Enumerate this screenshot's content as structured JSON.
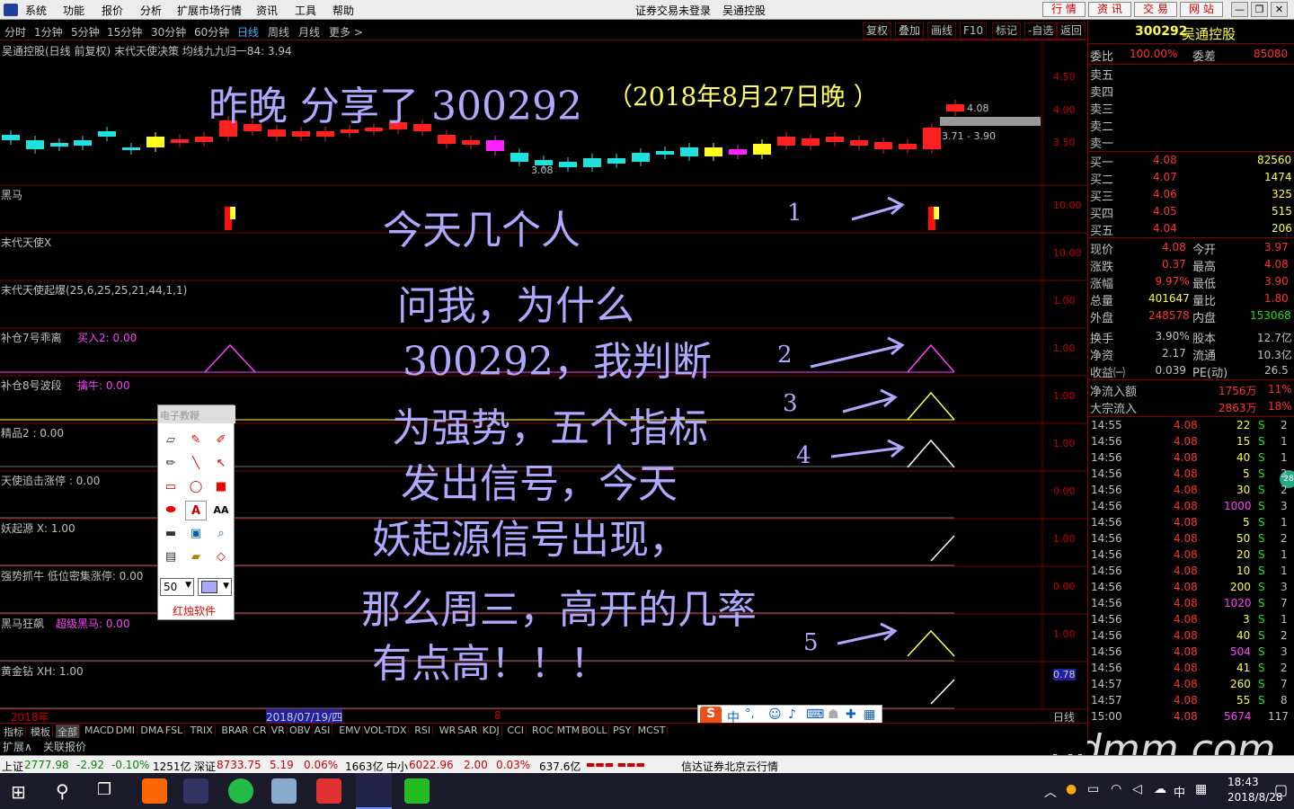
{
  "menu": {
    "items": [
      "系统",
      "功能",
      "报价",
      "分析",
      "扩展市场行情",
      "资讯",
      "工具",
      "帮助"
    ],
    "center_status": "证券交易未登录",
    "center_stock": "吴通控股",
    "quick": [
      "行 情",
      "资 讯",
      "交 易",
      "网 站"
    ]
  },
  "periods": {
    "items": [
      "分时",
      "1分钟",
      "5分钟",
      "15分钟",
      "30分钟",
      "60分钟",
      "日线",
      "周线",
      "月线",
      "更多 >"
    ],
    "tools": [
      "复权",
      "叠加",
      "画线",
      "F10",
      "标记",
      "-自选",
      "返回"
    ]
  },
  "chart": {
    "header": "吴通控股(日线 前复权) 末代天使决策  均线九九归一84: 3.94",
    "price_scale": [
      "4.50",
      "4.00",
      "3.50"
    ],
    "high_label": "4.08",
    "range_label": "3.71 - 3.90",
    "low_label": "3.08",
    "panels": [
      {
        "label": "黑马",
        "scale": "10.00"
      },
      {
        "label": "末代天使X",
        "scale": "10.00"
      },
      {
        "label": "末代天使起爆(25,6,25,25,21,44,1,1)",
        "scale": "1.00"
      },
      {
        "label": "补仓7号乖离",
        "extra": "买入2: 0.00",
        "scale": "1.00"
      },
      {
        "label": "补仓8号波段",
        "extra": "擒牛: 0.00",
        "scale": "1.00"
      },
      {
        "label": "精品2 : 0.00",
        "scale": "1.00"
      },
      {
        "label": "天使追击涨停 : 0.00",
        "scale": "0.00"
      },
      {
        "label": "妖起源  X: 1.00",
        "scale": "1.00"
      },
      {
        "label": "强势抓牛  低位密集涨停: 0.00",
        "scale": "0.00"
      },
      {
        "label": "黑马狂飙",
        "extra": "超级黑马: 0.00",
        "scale": "1.00"
      },
      {
        "label": "黄金钻  XH: 1.00",
        "scale": "0.78"
      }
    ],
    "date_left": "2018年",
    "date_mid": "2018/07/19/四",
    "date_right": "8",
    "day_label": "日线"
  },
  "annotations": {
    "title": "昨晚 分享了 300292",
    "title_date": "（2018年8月27日晚 ）",
    "lines": [
      "今天几个人",
      "问我，为什么",
      "300292，我判断",
      "为强势，五个指标",
      "发出信号，今天",
      "妖起源信号出现，",
      "那么周三，高开的几率",
      "有点高！！！"
    ],
    "numbers": [
      "1",
      "2",
      "3",
      "4",
      "5"
    ]
  },
  "toolbox": {
    "title": "电子教鞭",
    "size": "50",
    "brand": "红烛软件"
  },
  "idx_tabs": [
    "指标",
    "模板",
    "全部",
    "MACD",
    "DMI",
    "DMA",
    "FSL",
    "TRIX",
    "BRAR",
    "CR",
    "VR",
    "OBV",
    "ASI",
    "EMV",
    "VOL-TDX",
    "RSI",
    "WR",
    "SAR",
    "KDJ",
    "CCI",
    "ROC",
    "MTM",
    "BOLL",
    "PSY",
    "MCST"
  ],
  "sub_tabs": [
    "扩展∧",
    "关联报价"
  ],
  "quote": {
    "code": "300292",
    "name": "吴通控股",
    "weibi_label": "委比",
    "weibi": "100.00%",
    "weicha_label": "委差",
    "weicha": "85080",
    "sells": [
      "卖五",
      "卖四",
      "卖三",
      "卖二",
      "卖一"
    ],
    "buys": [
      {
        "l": "买一",
        "p": "4.08",
        "v": "82560"
      },
      {
        "l": "买二",
        "p": "4.07",
        "v": "1474"
      },
      {
        "l": "买三",
        "p": "4.06",
        "v": "325"
      },
      {
        "l": "买四",
        "p": "4.05",
        "v": "515"
      },
      {
        "l": "买五",
        "p": "4.04",
        "v": "206"
      }
    ],
    "stats": [
      {
        "a": "现价",
        "av": "4.08",
        "b": "今开",
        "bv": "3.97"
      },
      {
        "a": "涨跌",
        "av": "0.37",
        "b": "最高",
        "bv": "4.08"
      },
      {
        "a": "涨幅",
        "av": "9.97%",
        "b": "最低",
        "bv": "3.90"
      },
      {
        "a": "总量",
        "av": "401647",
        "b": "量比",
        "bv": "1.80"
      },
      {
        "a": "外盘",
        "av": "248578",
        "b": "内盘",
        "bv": "153068"
      },
      {
        "a": "换手",
        "av": "3.90%",
        "b": "股本",
        "bv": "12.7亿"
      },
      {
        "a": "净资",
        "av": "2.17",
        "b": "流通",
        "bv": "10.3亿"
      },
      {
        "a": "收益㈠",
        "av": "0.039",
        "b": "PE(动)",
        "bv": "26.5"
      }
    ],
    "flow1_label": "净流入额",
    "flow1": "1756万",
    "flow1p": "11%",
    "flow2_label": "大宗流入",
    "flow2": "2863万",
    "flow2p": "18%"
  },
  "ticks": [
    {
      "t": "14:55",
      "p": "4.08",
      "v": "22",
      "s": "S",
      "n": "2"
    },
    {
      "t": "14:56",
      "p": "4.08",
      "v": "15",
      "s": "S",
      "n": "1"
    },
    {
      "t": "14:56",
      "p": "4.08",
      "v": "40",
      "s": "S",
      "n": "1"
    },
    {
      "t": "14:56",
      "p": "4.08",
      "v": "5",
      "s": "S",
      "n": "2"
    },
    {
      "t": "14:56",
      "p": "4.08",
      "v": "30",
      "s": "S",
      "n": "2"
    },
    {
      "t": "14:56",
      "p": "4.08",
      "v": "1000",
      "s": "S",
      "n": "3"
    },
    {
      "t": "14:56",
      "p": "4.08",
      "v": "5",
      "s": "S",
      "n": "1"
    },
    {
      "t": "14:56",
      "p": "4.08",
      "v": "50",
      "s": "S",
      "n": "2"
    },
    {
      "t": "14:56",
      "p": "4.08",
      "v": "20",
      "s": "S",
      "n": "1"
    },
    {
      "t": "14:56",
      "p": "4.08",
      "v": "10",
      "s": "S",
      "n": "1"
    },
    {
      "t": "14:56",
      "p": "4.08",
      "v": "200",
      "s": "S",
      "n": "3"
    },
    {
      "t": "14:56",
      "p": "4.08",
      "v": "1020",
      "s": "S",
      "n": "7"
    },
    {
      "t": "14:56",
      "p": "4.08",
      "v": "3",
      "s": "S",
      "n": "1"
    },
    {
      "t": "14:56",
      "p": "4.08",
      "v": "40",
      "s": "S",
      "n": "2"
    },
    {
      "t": "14:56",
      "p": "4.08",
      "v": "504",
      "s": "S",
      "n": "3"
    },
    {
      "t": "14:56",
      "p": "4.08",
      "v": "41",
      "s": "S",
      "n": "2"
    },
    {
      "t": "14:57",
      "p": "4.08",
      "v": "260",
      "s": "S",
      "n": "7"
    },
    {
      "t": "14:57",
      "p": "4.08",
      "v": "55",
      "s": "S",
      "n": "8"
    },
    {
      "t": "15:00",
      "p": "4.08",
      "v": "5674",
      "s": "",
      "n": "117"
    }
  ],
  "status": {
    "sh_label": "上证",
    "sh": "2777.98",
    "sh_chg": "-2.92",
    "sh_pct": "-0.10%",
    "sh_amt": "1251亿",
    "sz_label": "深证",
    "sz": "8733.75",
    "sz_chg": "5.19",
    "sz_pct": "0.06%",
    "sz_amt": "1663亿",
    "zx_label": "中小",
    "zx": "6022.96",
    "zx_chg": "2.00",
    "zx_pct": "0.03%",
    "zx_amt": "637.6亿",
    "server": "信达证券北京云行情"
  },
  "ime": {
    "label": "中"
  },
  "watermark": "gdmm.com",
  "taskbar": {
    "time": "18:43",
    "date": "2018/8/28",
    "lang": "中"
  }
}
